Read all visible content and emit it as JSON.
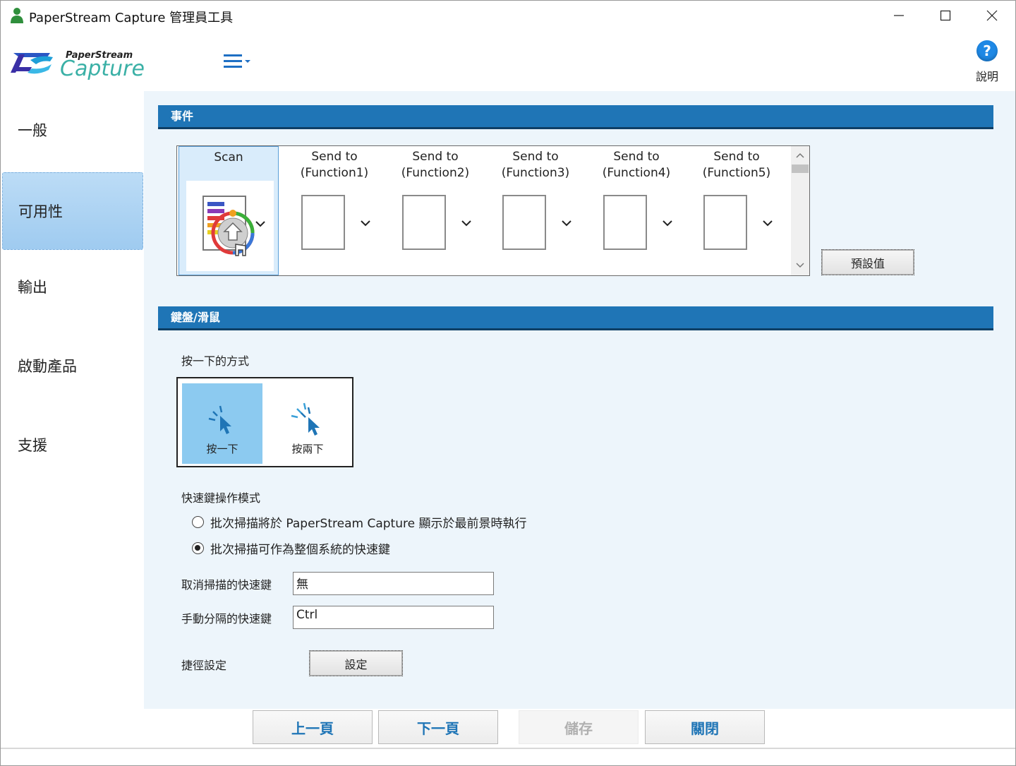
{
  "window": {
    "title": "PaperStream Capture 管理員工具"
  },
  "header": {
    "logo_top": "PaperStream",
    "logo_main": "Capture",
    "help_label": "說明"
  },
  "sidebar": {
    "items": [
      {
        "label": "一般"
      },
      {
        "label": "可用性"
      },
      {
        "label": "輸出"
      },
      {
        "label": "啟動產品"
      },
      {
        "label": "支援"
      }
    ]
  },
  "events": {
    "section_title": "事件",
    "columns": [
      {
        "line1": "Scan",
        "line2": ""
      },
      {
        "line1": "Send to",
        "line2": "(Function1)"
      },
      {
        "line1": "Send to",
        "line2": "(Function2)"
      },
      {
        "line1": "Send to",
        "line2": "(Function3)"
      },
      {
        "line1": "Send to",
        "line2": "(Function4)"
      },
      {
        "line1": "Send to",
        "line2": "(Function5)"
      }
    ],
    "default_button": "預設值"
  },
  "keyboard": {
    "section_title": "鍵盤/滑鼠",
    "click_mode_label": "按一下的方式",
    "single_click": "按一下",
    "double_click": "按兩下",
    "hotkey_mode_label": "快速鍵操作模式",
    "radio_foreground": "批次掃描將於 PaperStream Capture 顯示於最前景時執行",
    "radio_global": "批次掃描可作為整個系統的快速鍵",
    "cancel_scan_label": "取消掃描的快速鍵",
    "cancel_scan_value": "無",
    "manual_sep_label": "手動分隔的快速鍵",
    "manual_sep_value": "Ctrl",
    "shortcut_label": "捷徑設定",
    "shortcut_button": "設定"
  },
  "footer": {
    "prev": "上一頁",
    "next": "下一頁",
    "save": "儲存",
    "close": "關閉"
  }
}
